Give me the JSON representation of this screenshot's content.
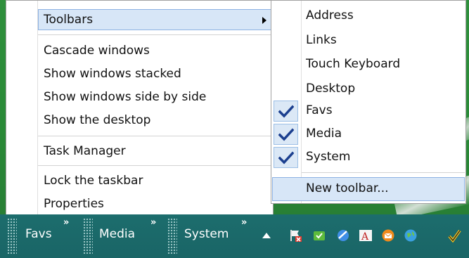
{
  "context_menu": {
    "items": [
      {
        "label": "Toolbars",
        "has_submenu": true,
        "highlighted": true
      },
      {
        "label": "Cascade windows"
      },
      {
        "label": "Show windows stacked"
      },
      {
        "label": "Show windows side by side"
      },
      {
        "label": "Show the desktop"
      },
      {
        "label": "Task Manager"
      },
      {
        "label": "Lock the taskbar"
      },
      {
        "label": "Properties"
      }
    ]
  },
  "toolbars_submenu": {
    "items": [
      {
        "label": "Address",
        "checked": false
      },
      {
        "label": "Links",
        "checked": false
      },
      {
        "label": "Touch Keyboard",
        "checked": false
      },
      {
        "label": "Desktop",
        "checked": false
      },
      {
        "label": "Favs",
        "checked": true
      },
      {
        "label": "Media",
        "checked": true
      },
      {
        "label": "System",
        "checked": true
      },
      {
        "label": "New toolbar...",
        "highlighted": true
      }
    ]
  },
  "taskbar": {
    "toolbars": [
      {
        "label": "Favs",
        "chevron": "»"
      },
      {
        "label": "Media",
        "chevron": "»"
      },
      {
        "label": "System",
        "chevron": "»"
      }
    ],
    "tray_icons": [
      "show-hidden-icons-arrow",
      "flag-icon",
      "security-icon",
      "bluetooth-icon",
      "font-icon",
      "mail-icon",
      "network-globe-icon",
      "check-icon"
    ]
  },
  "colors": {
    "taskbar": "#1a6767",
    "desktop": "#2c8a3a",
    "highlight": "#d7e6f7",
    "highlight_border": "#8db2e3",
    "checkmark": "#1b3f8f"
  }
}
